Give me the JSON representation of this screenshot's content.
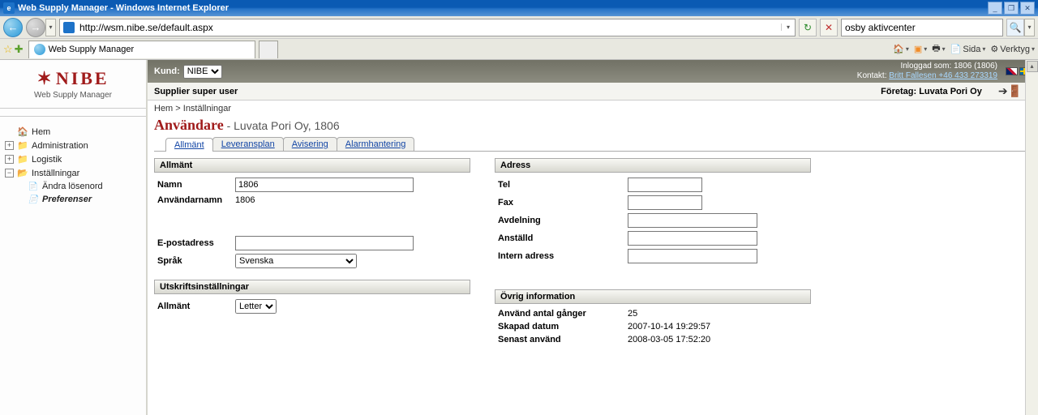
{
  "window_title": "Web Supply Manager - Windows Internet Explorer",
  "address_url": "http://wsm.nibe.se/default.aspx",
  "search_value": "osby aktivcenter",
  "tab_title": "Web Supply Manager",
  "toolbar": {
    "sida": "Sida",
    "verktyg": "Verktyg"
  },
  "brand": {
    "name": "NIBE",
    "sub": "Web Supply Manager"
  },
  "topstrip": {
    "kund_label": "Kund:",
    "kund_option": "NIBE",
    "logged_in_label": "Inloggad som: 1806 (1806)",
    "kontakt_label": "Kontakt:",
    "kontakt_name": "Britt Fallesen +46 433 273319"
  },
  "substrip": {
    "role": "Supplier super user",
    "company_label": "Företag:",
    "company_value": "Luvata Pori Oy"
  },
  "breadcrumb": "Hem > Inställningar",
  "page": {
    "title": "Användare",
    "sub": " - Luvata Pori Oy, 1806"
  },
  "tabs": [
    "Allmänt",
    "Leveransplan",
    "Avisering",
    "Alarmhantering"
  ],
  "sidebar": {
    "hem": "Hem",
    "admin": "Administration",
    "logistik": "Logistik",
    "inst": "Inställningar",
    "andra": "Ändra lösenord",
    "pref": "Preferenser"
  },
  "sections": {
    "allmant": "Allmänt",
    "adress": "Adress",
    "utskrift": "Utskriftsinställningar",
    "ovrig": "Övrig information"
  },
  "form": {
    "namn_lbl": "Namn",
    "namn_val": "1806",
    "anvnamn_lbl": "Användarnamn",
    "anvnamn_val": "1806",
    "email_lbl": "E-postadress",
    "email_val": "",
    "sprak_lbl": "Språk",
    "sprak_opt": "Svenska",
    "tel_lbl": "Tel",
    "tel_val": "",
    "fax_lbl": "Fax",
    "fax_val": "",
    "avd_lbl": "Avdelning",
    "avd_val": "",
    "anst_lbl": "Anställd",
    "anst_val": "",
    "intern_lbl": "Intern adress",
    "intern_val": "",
    "allmant_print_lbl": "Allmänt",
    "allmant_print_opt": "Letter",
    "anvand_lbl": "Använd antal gånger",
    "anvand_val": "25",
    "skapad_lbl": "Skapad datum",
    "skapad_val": "2007-10-14 19:29:57",
    "senast_lbl": "Senast använd",
    "senast_val": "2008-03-05 17:52:20"
  }
}
